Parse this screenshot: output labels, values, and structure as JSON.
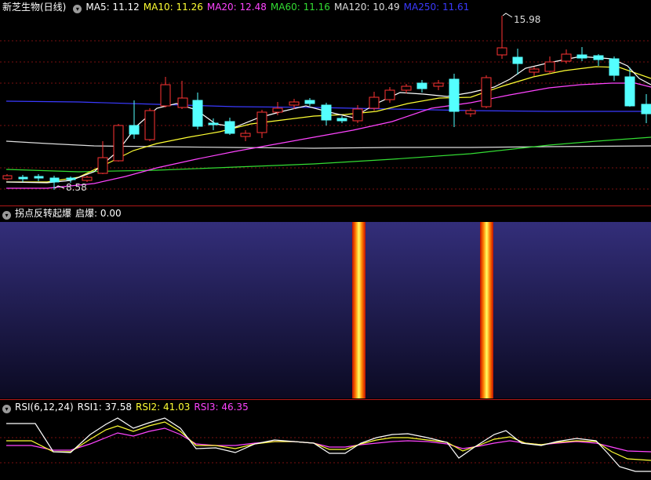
{
  "colors": {
    "up": "#ff3333",
    "down": "#54ffff",
    "ma5": "#ffffff",
    "ma10": "#ffff33",
    "ma20": "#ff44ff",
    "ma60": "#33dd33",
    "ma120": "#dddddd",
    "ma250": "#3a3aff",
    "grid": "#7a1010",
    "separator": "#b01818",
    "panel_top": "#332e7a",
    "panel_bottom": "#0b0a22"
  },
  "main": {
    "title": "新芝生物(日线)",
    "ma5_label": "MA5: 11.12",
    "ma10_label": "MA10: 11.26",
    "ma20_label": "MA20: 12.48",
    "ma60_label": "MA60: 11.16",
    "ma120_label": "MA120: 10.49",
    "ma250_label": "MA250: 11.61",
    "high_label": "15.98",
    "low_label": "8.58"
  },
  "indicator": {
    "title": "拐点反转起爆",
    "value_label": "启爆: 0.00"
  },
  "rsi": {
    "title": "RSI(6,12,24)",
    "rsi1_label": "RSI1: 37.58",
    "rsi2_label": "RSI2: 41.03",
    "rsi3_label": "RSI3: 46.35"
  },
  "icons": [
    "collapse-toggle-icon"
  ]
}
